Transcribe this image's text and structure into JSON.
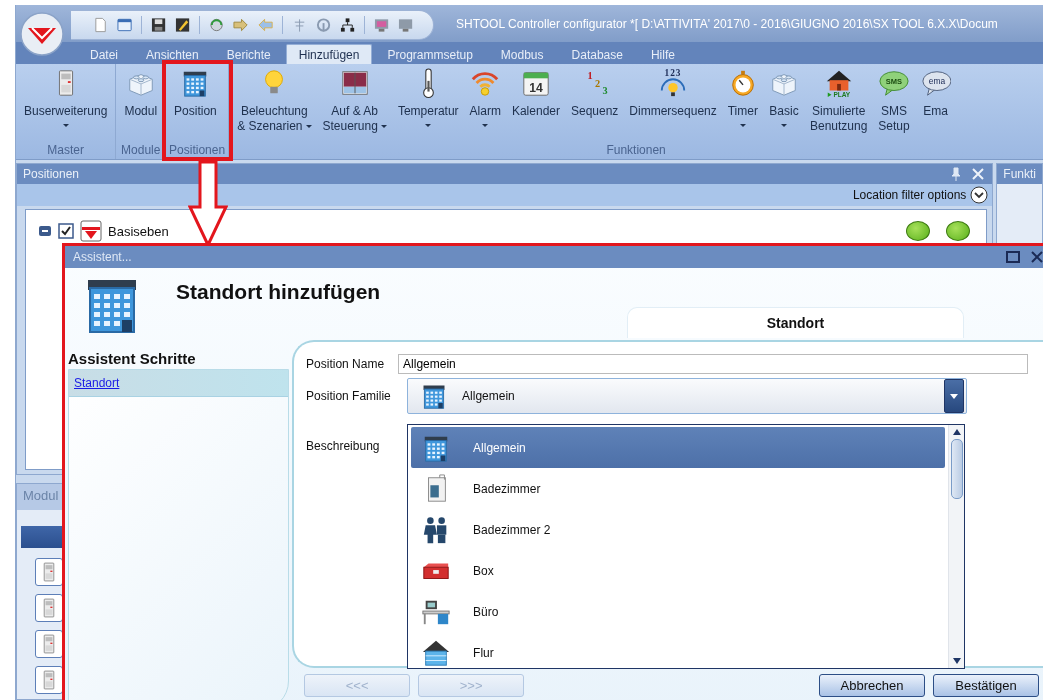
{
  "window": {
    "title": "SHTOOL Controller configurator *[ D:\\ATTIVITA' 2017\\0 - 2016\\GIUGNO 2016\\SX TOOL 6.X.X\\Docum"
  },
  "menu_tabs": [
    {
      "label": "Datei",
      "selected": false
    },
    {
      "label": "Ansichten",
      "selected": false
    },
    {
      "label": "Berichte",
      "selected": false
    },
    {
      "label": "Hinzufügen",
      "selected": true
    },
    {
      "label": "Programmsetup",
      "selected": false
    },
    {
      "label": "Modbus",
      "selected": false
    },
    {
      "label": "Database",
      "selected": false
    },
    {
      "label": "Hilfe",
      "selected": false
    }
  ],
  "ribbon": {
    "groups": [
      {
        "label": "Master",
        "highlighted": false,
        "buttons": [
          {
            "kind": "device",
            "lines": [
              "Buserweiterung"
            ],
            "dropdown": true
          }
        ]
      },
      {
        "label": "Module",
        "highlighted": false,
        "buttons": [
          {
            "kind": "cube",
            "lines": [
              "Modul"
            ],
            "dropdown": false
          }
        ]
      },
      {
        "label": "Positionen",
        "highlighted": true,
        "buttons": [
          {
            "kind": "building",
            "lines": [
              "Position"
            ],
            "dropdown": false
          }
        ]
      },
      {
        "label": "Funktionen",
        "highlighted": false,
        "buttons": [
          {
            "kind": "bulb",
            "lines": [
              "Beleuchtung",
              "& Szenarien"
            ],
            "dropdown": true
          },
          {
            "kind": "blind",
            "lines": [
              "Auf & Ab",
              "Steuerung"
            ],
            "dropdown": true
          },
          {
            "kind": "thermometer",
            "lines": [
              "Temperatur"
            ],
            "dropdown": true
          },
          {
            "kind": "wifi",
            "lines": [
              "Alarm"
            ],
            "dropdown": true
          },
          {
            "kind": "calendar",
            "icon_text": "14",
            "lines": [
              "Kalender"
            ],
            "dropdown": false
          },
          {
            "kind": "numbers",
            "icon_text": "123",
            "lines": [
              "Sequenz"
            ],
            "dropdown": false
          },
          {
            "kind": "dimmer",
            "icon_text": "123",
            "lines": [
              "Dimmersequenz"
            ],
            "dropdown": false
          },
          {
            "kind": "stopwatch",
            "lines": [
              "Timer"
            ],
            "dropdown": true
          },
          {
            "kind": "cube",
            "lines": [
              "Basic"
            ],
            "dropdown": true
          },
          {
            "kind": "house",
            "icon_text": "PLAY",
            "lines": [
              "Simulierte",
              "Benutzung"
            ],
            "dropdown": false
          },
          {
            "kind": "sms",
            "icon_text": "SMS",
            "lines": [
              "SMS",
              "Setup"
            ],
            "dropdown": false
          },
          {
            "kind": "email",
            "icon_text": "ema",
            "lines": [
              "Ema"
            ],
            "dropdown": false
          }
        ]
      }
    ]
  },
  "positions_panel": {
    "title": "Positionen",
    "filter_label": "Location filter options",
    "tree": [
      {
        "label": "Basiseben",
        "expanded": true,
        "checked": true
      }
    ]
  },
  "functions_panel": {
    "title": "Funkti"
  },
  "modules_panel": {
    "title": "Modul"
  },
  "dialog": {
    "title": "Assistent...",
    "heading": "Standort hinzufügen",
    "tab": "Standort",
    "steps_heading": "Assistent Schritte",
    "steps": [
      {
        "label": "Standort",
        "selected": true
      }
    ],
    "name_label": "Position Name",
    "name_value": "Allgemein",
    "family_label": "Position Familie",
    "family_value": "Allgemein",
    "family_expanded": true,
    "family_options": [
      {
        "kind": "building",
        "label": "Allgemein",
        "selected": true
      },
      {
        "kind": "bath",
        "label": "Badezimmer",
        "selected": false
      },
      {
        "kind": "people",
        "label": "Badezimmer 2",
        "selected": false
      },
      {
        "kind": "toolbox",
        "label": "Box",
        "selected": false
      },
      {
        "kind": "desk",
        "label": "Büro",
        "selected": false
      },
      {
        "kind": "houseblue",
        "label": "Flur",
        "selected": false
      }
    ],
    "description_label": "Beschreibung",
    "buttons": [
      {
        "label": "<<<",
        "disabled": true
      },
      {
        "label": ">>>",
        "disabled": true
      },
      {
        "label": "Abbrechen",
        "disabled": false
      },
      {
        "label": "Bestätigen",
        "disabled": false
      }
    ]
  }
}
